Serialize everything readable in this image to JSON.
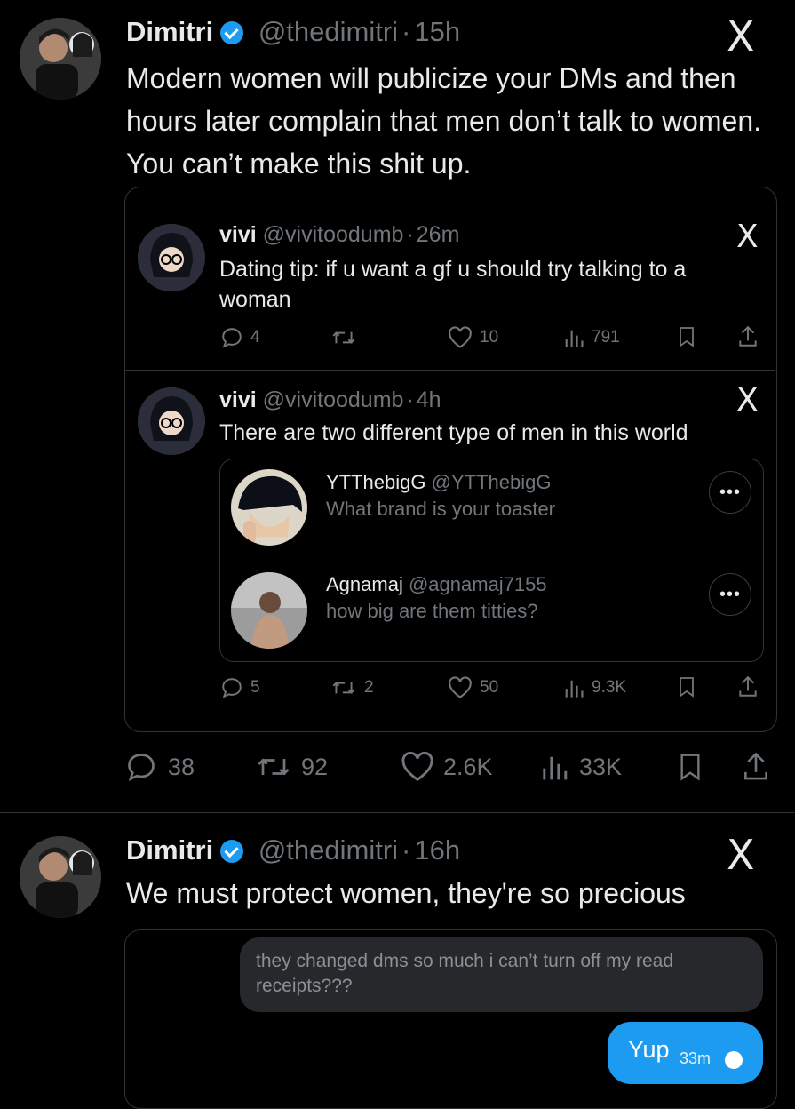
{
  "tweet1": {
    "name": "Dimitri",
    "handle": "@thedimitri",
    "sep": "·",
    "time": "15h",
    "text": "Modern women will publicize your DMs and then hours later complain that men don’t talk to women. You can’t make this shit up.",
    "stats": {
      "replies": "38",
      "retweets": "92",
      "likes": "2.6K",
      "views": "33K"
    }
  },
  "quote1": {
    "name": "vivi",
    "handle": "@vivitoodumb",
    "sep": "·",
    "time": "26m",
    "text": "Dating tip: if u want a gf u should try talking to a woman",
    "stats": {
      "replies": "4",
      "retweets": "",
      "likes": "10",
      "views": "791"
    }
  },
  "quote2": {
    "name": "vivi",
    "handle": "@vivitoodumb",
    "sep": "·",
    "time": "4h",
    "text": "There are two different type of men in this world",
    "stats": {
      "replies": "5",
      "retweets": "2",
      "likes": "50",
      "views": "9.3K"
    },
    "messages": [
      {
        "name": "YTThebigG",
        "handle": "@YTThebigG",
        "text": "What brand is your toaster"
      },
      {
        "name": "Agnamaj",
        "handle": "@agnamaj7155",
        "text": "how big are them titties?"
      }
    ]
  },
  "tweet2": {
    "name": "Dimitri",
    "handle": "@thedimitri",
    "sep": "·",
    "time": "16h",
    "text": "We must protect women, they're so precious",
    "dm_received": "they  changed dms so much i can’t turn off my read receipts???",
    "dm_sent": "Yup",
    "dm_sent_time": "33m"
  },
  "icons": {
    "x_logo": "X",
    "more": "•••"
  },
  "colors": {
    "accent": "#1d9bf0",
    "bg": "#000000",
    "muted": "#71767b"
  }
}
